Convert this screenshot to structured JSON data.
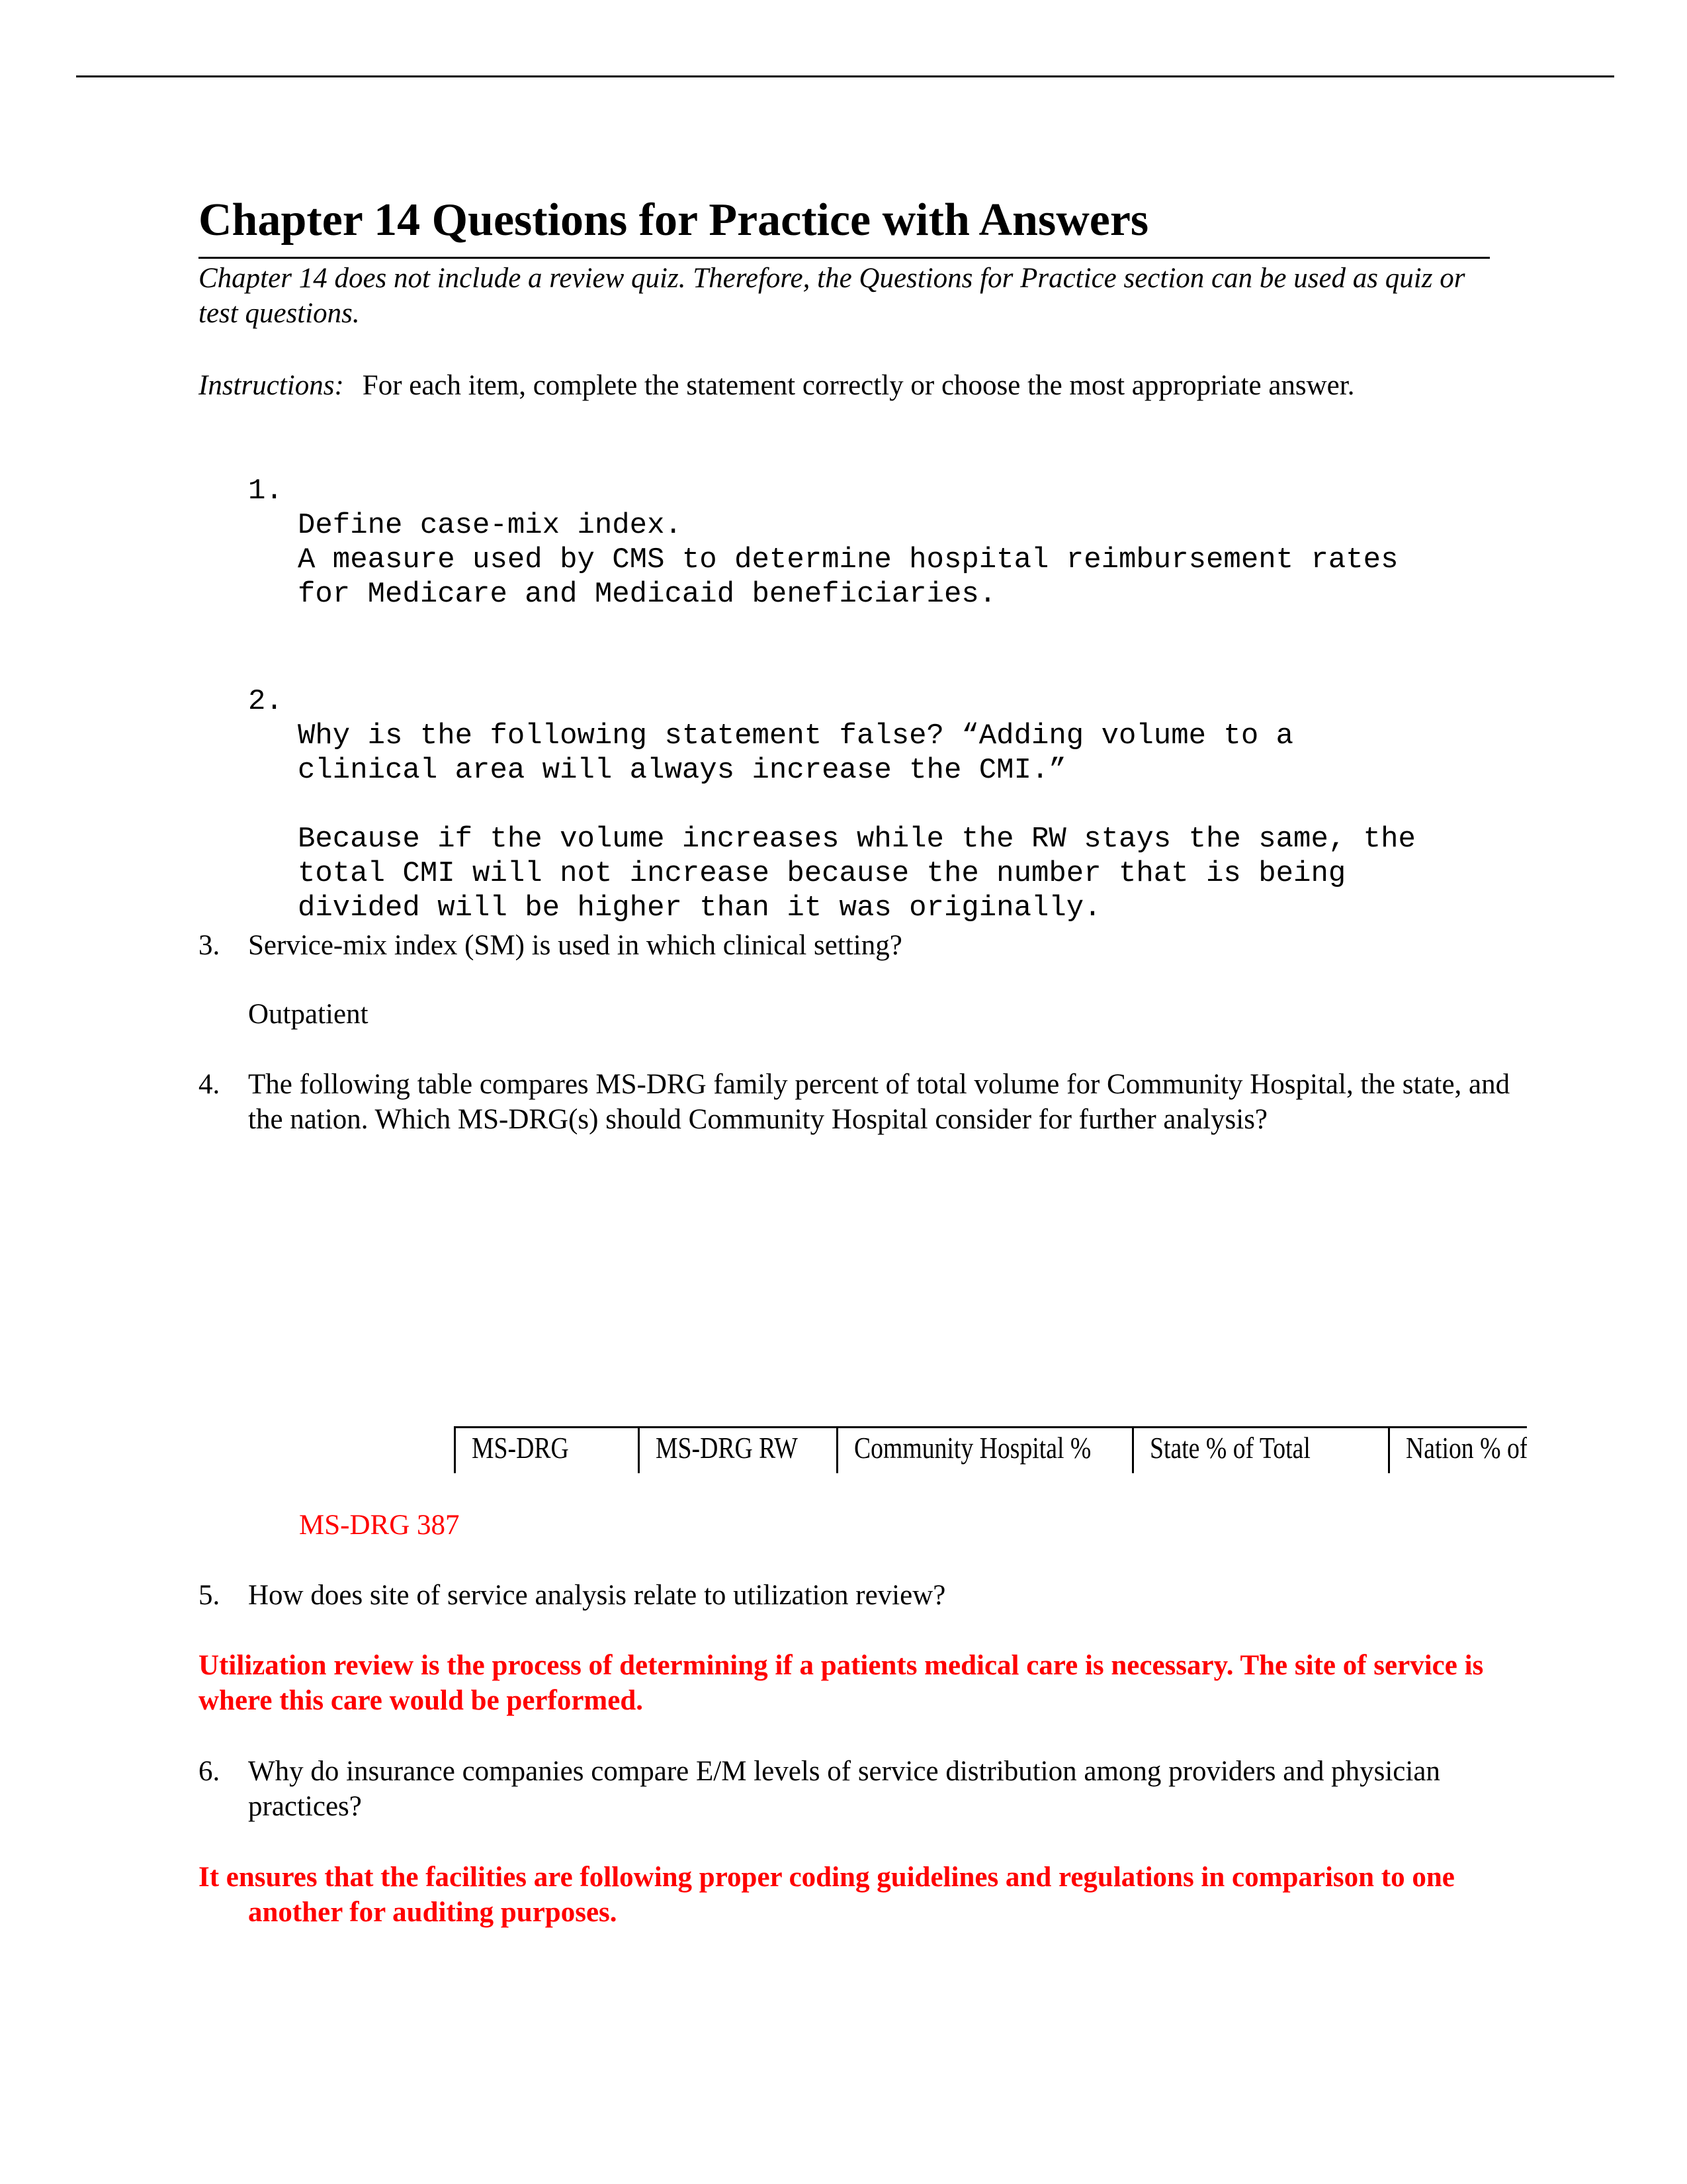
{
  "document": {
    "title": "Chapter 14 Questions for Practice with Answers",
    "intro": "Chapter 14 does not include a review quiz. Therefore, the Questions for Practice section can be used as quiz or test questions.",
    "instructions_label": "Instructions:",
    "instructions_text": "For each item, complete the statement correctly or choose the most appropriate answer."
  },
  "questions": [
    {
      "number": "1.",
      "text": "Define case-mix index.\nA measure used by CMS to determine hospital reimbursement rates\nfor Medicare and Medicaid beneficiaries."
    },
    {
      "number": "2.",
      "text": "Why is the following statement false? “Adding volume to a\nclinical area will always increase the CMI.”\n\nBecause if the volume increases while the RW stays the same, the\ntotal CMI will not increase because the number that is being\ndivided will be higher than it was originally."
    },
    {
      "number": "3.",
      "text": "Service-mix index (SM) is used in which clinical setting?",
      "answer": "Outpatient"
    },
    {
      "number": "4.",
      "text": "The following table compares MS-DRG family percent of total volume for Community Hospital, the state, and the nation. Which MS-DRG(s) should Community Hospital consider for further analysis?",
      "table_headers": [
        "MS-DRG",
        "MS-DRG RW",
        "Community Hospital %",
        "State % of Total",
        "Nation % of Total"
      ],
      "answer": "MS-DRG 387"
    },
    {
      "number": "5.",
      "text": "How does site of service analysis relate to utilization review?",
      "answer": "Utilization review is the process of determining if a patients medical care is necessary. The site of service is where this care would be performed."
    },
    {
      "number": "6.",
      "text": "Why do insurance companies compare E/M levels of service distribution among providers and physician practices?",
      "answer": "It ensures that the facilities are following proper coding guidelines and regulations in comparison to one another for auditing purposes."
    }
  ],
  "colors": {
    "answer_red": "#ff0000",
    "text": "#000000"
  }
}
